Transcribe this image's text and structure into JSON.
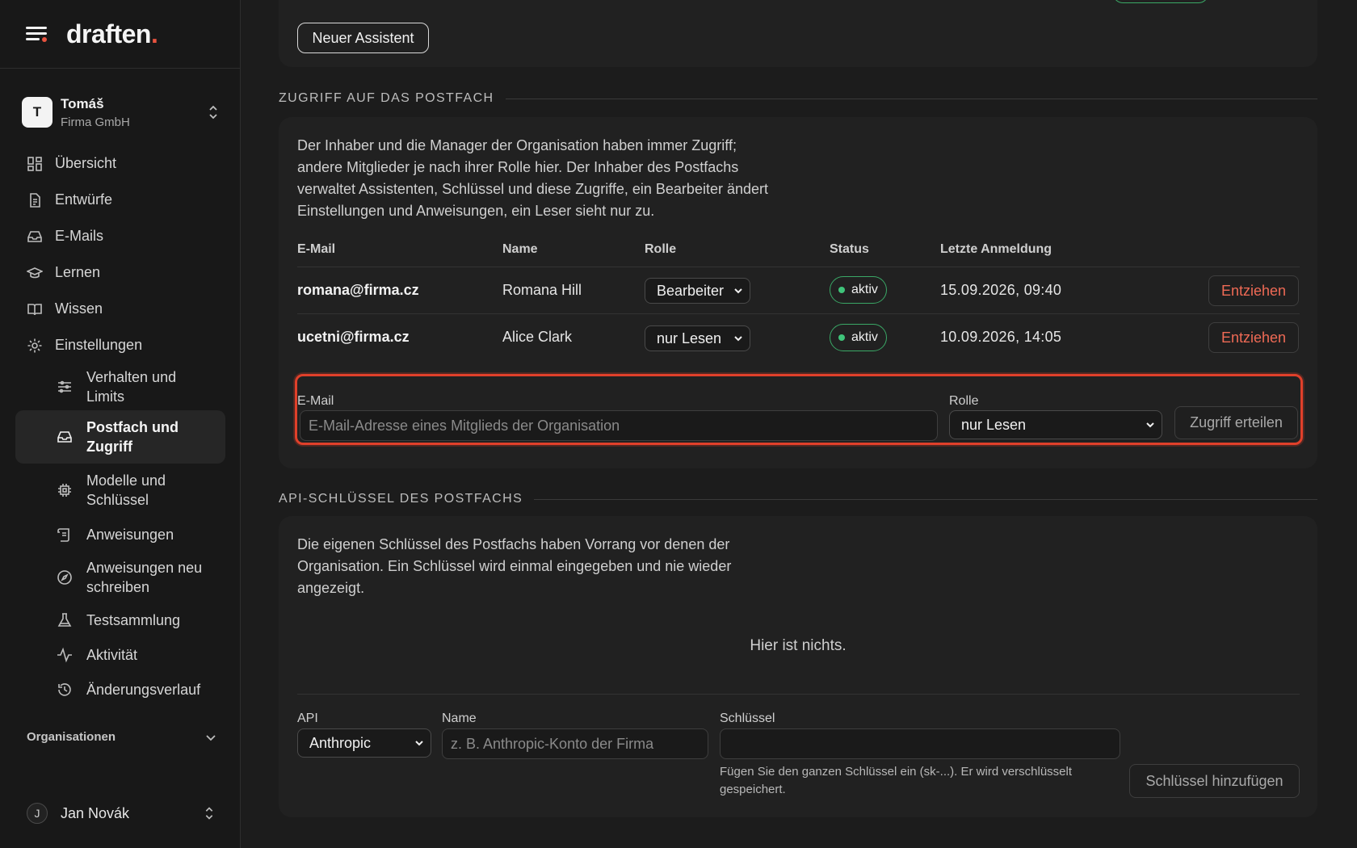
{
  "brand": {
    "logo_text": "draften",
    "logo_dot": "."
  },
  "account": {
    "initial": "T",
    "name": "Tomáš",
    "org": "Firma GmbH"
  },
  "nav": {
    "items": [
      {
        "label": "Übersicht",
        "icon": "dashboard-icon"
      },
      {
        "label": "Entwürfe",
        "icon": "document-icon"
      },
      {
        "label": "E-Mails",
        "icon": "inbox-icon"
      },
      {
        "label": "Lernen",
        "icon": "graduation-cap-icon"
      },
      {
        "label": "Wissen",
        "icon": "book-icon"
      },
      {
        "label": "Einstellungen",
        "icon": "gear-icon"
      }
    ],
    "sub": [
      {
        "label": "Verhalten und Limits",
        "icon": "sliders-icon"
      },
      {
        "label": "Postfach und Zugriff",
        "icon": "inbox-icon",
        "active": true
      },
      {
        "label": "Modelle und Schlüssel",
        "icon": "chip-icon"
      },
      {
        "label": "Anweisungen",
        "icon": "scroll-icon"
      },
      {
        "label": "Anweisungen neu schreiben",
        "icon": "compass-icon"
      },
      {
        "label": "Testsammlung",
        "icon": "flask-icon"
      },
      {
        "label": "Aktivität",
        "icon": "activity-icon"
      },
      {
        "label": "Änderungsverlauf",
        "icon": "history-icon"
      }
    ],
    "organisations_label": "Organisationen"
  },
  "user": {
    "initial": "J",
    "name": "Jan Novák"
  },
  "top_card": {
    "new_assistant_label": "Neuer Assistent"
  },
  "access": {
    "heading": "ZUGRIFF AUF DAS POSTFACH",
    "description": "Der Inhaber und die Manager der Organisation haben immer Zugriff; andere Mitglieder je nach ihrer Rolle hier. Der Inhaber des Postfachs verwaltet Assistenten, Schlüssel und diese Zugriffe, ein Bearbeiter ändert Einstellungen und Anweisungen, ein Leser sieht nur zu.",
    "columns": {
      "email": "E-Mail",
      "name": "Name",
      "role": "Rolle",
      "status": "Status",
      "last_login": "Letzte Anmeldung"
    },
    "rows": [
      {
        "email": "romana@firma.cz",
        "name": "Romana Hill",
        "role": "Bearbeiter",
        "status": "aktiv",
        "last_login": "15.09.2026, 09:40",
        "action": "Entziehen"
      },
      {
        "email": "ucetni@firma.cz",
        "name": "Alice Clark",
        "role": "nur Lesen",
        "status": "aktiv",
        "last_login": "10.09.2026, 14:05",
        "action": "Entziehen"
      }
    ],
    "grant": {
      "email_label": "E-Mail",
      "email_placeholder": "E-Mail-Adresse eines Mitglieds der Organisation",
      "role_label": "Rolle",
      "role_value": "nur Lesen",
      "submit_label": "Zugriff erteilen"
    }
  },
  "api_keys": {
    "heading": "API-SCHLÜSSEL DES POSTFACHS",
    "description": "Die eigenen Schlüssel des Postfachs haben Vorrang vor denen der Organisation. Ein Schlüssel wird einmal eingegeben und nie wieder angezeigt.",
    "empty_text": "Hier ist nichts.",
    "form": {
      "api_label": "API",
      "api_value": "Anthropic",
      "name_label": "Name",
      "name_placeholder": "z. B. Anthropic-Konto der Firma",
      "key_label": "Schlüssel",
      "key_help": "Fügen Sie den ganzen Schlüssel ein (sk-...). Er wird verschlüsselt gespeichert.",
      "submit_label": "Schlüssel hinzufügen"
    }
  },
  "colors": {
    "accent": "#e8533f",
    "danger": "#ef6a55",
    "success": "#3fc47a",
    "focus_ring": "#e0402a"
  }
}
